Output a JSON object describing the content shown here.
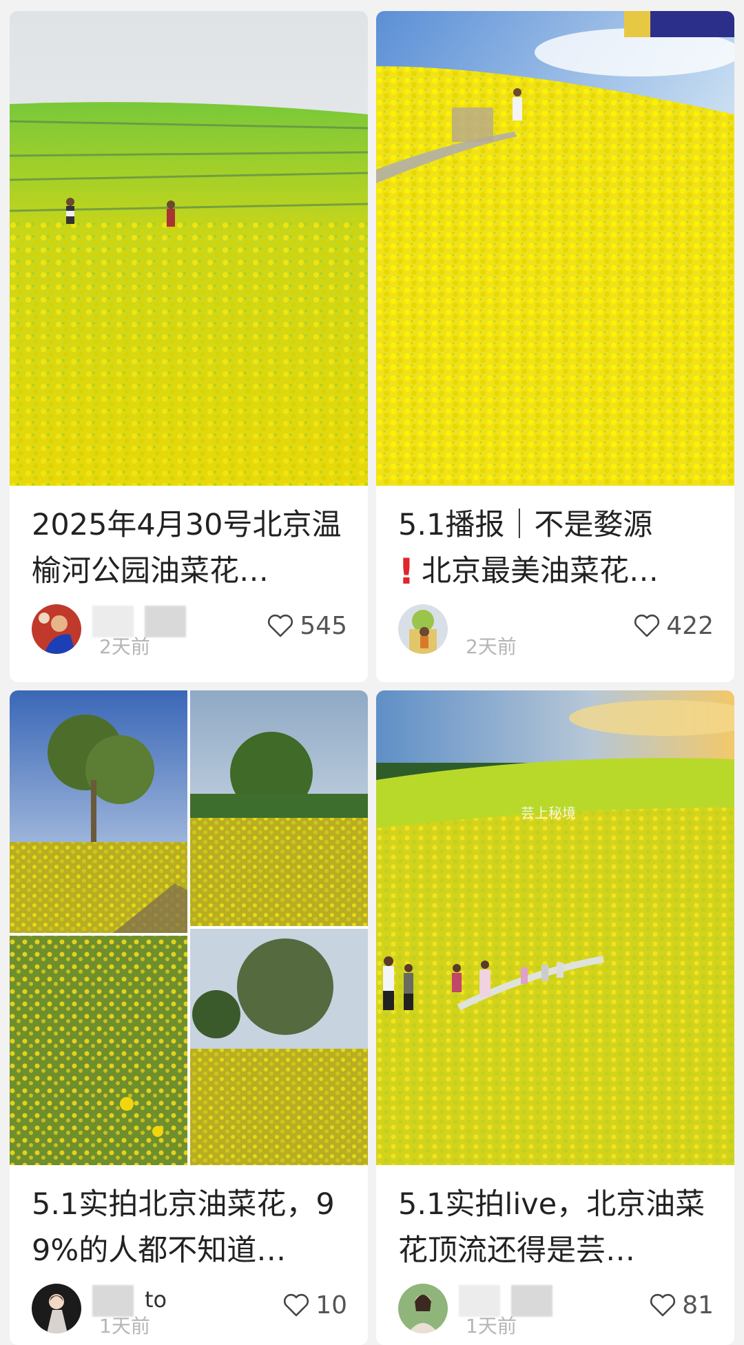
{
  "feed": {
    "cards": [
      {
        "title": "2025年4月30号北京温榆河公园油菜花…",
        "time": "2天前",
        "likes": "545",
        "author_visible": ""
      },
      {
        "title_prefix": "5.1播报｜不是婺源",
        "title_warn": "!",
        "title_suffix": "北京最美油菜花…",
        "time": "2天前",
        "likes": "422",
        "author_visible": ""
      },
      {
        "title": "5.1实拍北京油菜花，99%的人都不知道…",
        "time": "1天前",
        "likes": "10",
        "author_visible": "to"
      },
      {
        "title": "5.1实拍live，北京油菜花顶流还得是芸…",
        "time": "1天前",
        "likes": "81",
        "author_visible": "",
        "cover_watermark": "芸上秘境"
      }
    ],
    "icons": {
      "like": "heart-outline-icon"
    },
    "colors": {
      "background": "#f2f2f2",
      "card": "#ffffff",
      "text": "#222222",
      "muted": "#b5b5b5",
      "warn": "#e0262d",
      "field_yellow": "#e6d400",
      "field_green": "#6cc628"
    }
  }
}
